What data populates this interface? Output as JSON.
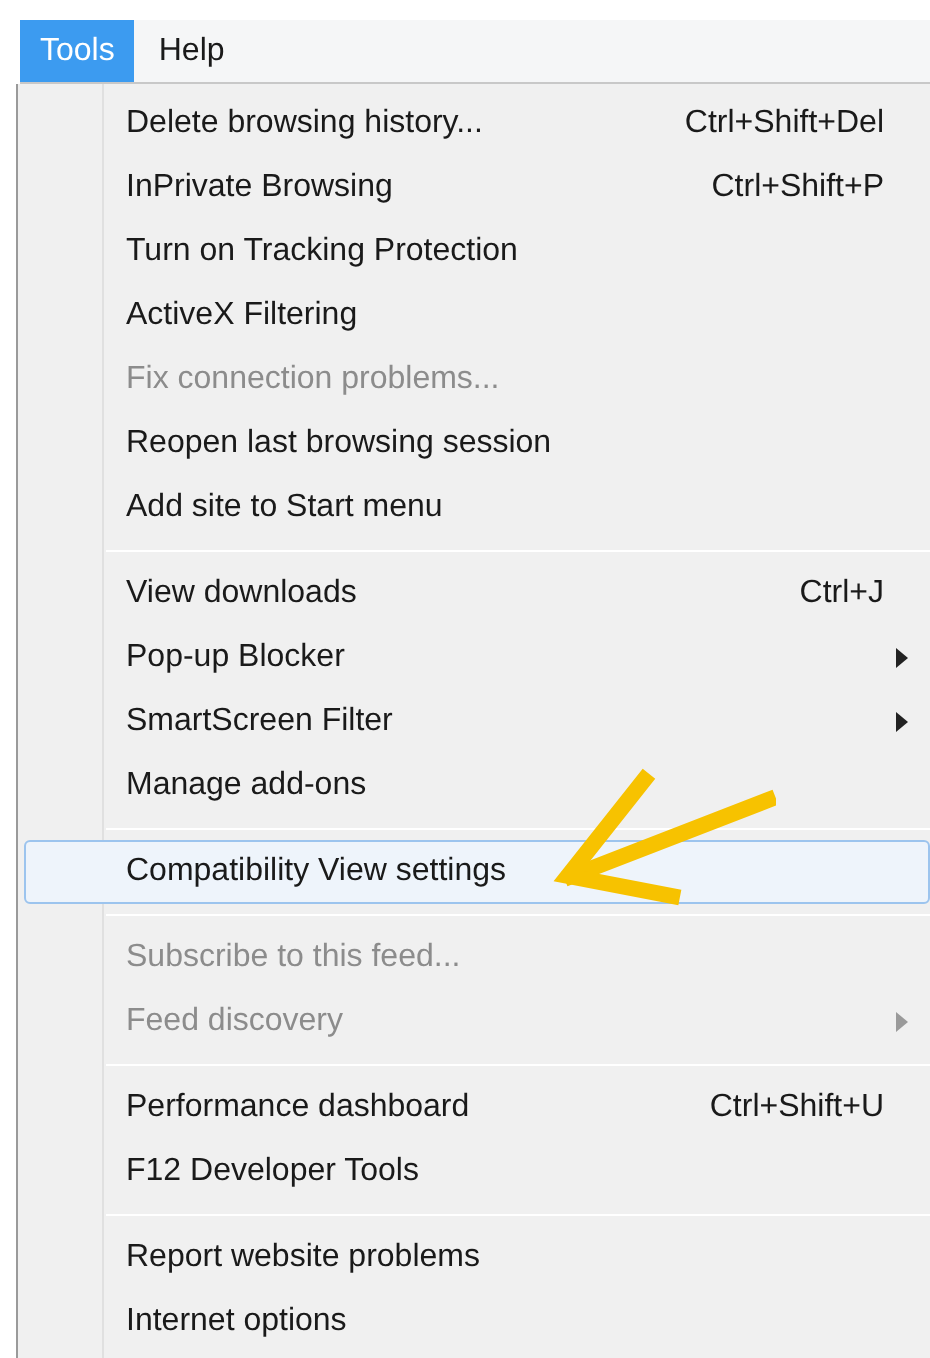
{
  "menubar": [
    {
      "label": "Tools",
      "selected": true
    },
    {
      "label": "Help",
      "selected": false
    }
  ],
  "menu": {
    "groups": [
      {
        "items": [
          {
            "label": "Delete browsing history...",
            "shortcut": "Ctrl+Shift+Del",
            "disabled": false,
            "selected": false,
            "submenu": false
          },
          {
            "label": "InPrivate Browsing",
            "shortcut": "Ctrl+Shift+P",
            "disabled": false,
            "selected": false,
            "submenu": false
          },
          {
            "label": "Turn on Tracking Protection",
            "disabled": false,
            "selected": false,
            "submenu": false
          },
          {
            "label": "ActiveX Filtering",
            "disabled": false,
            "selected": false,
            "submenu": false
          },
          {
            "label": "Fix connection problems...",
            "disabled": true,
            "selected": false,
            "submenu": false
          },
          {
            "label": "Reopen last browsing session",
            "disabled": false,
            "selected": false,
            "submenu": false
          },
          {
            "label": "Add site to Start menu",
            "disabled": false,
            "selected": false,
            "submenu": false
          }
        ]
      },
      {
        "items": [
          {
            "label": "View downloads",
            "shortcut": "Ctrl+J",
            "disabled": false,
            "selected": false,
            "submenu": false
          },
          {
            "label": "Pop-up Blocker",
            "disabled": false,
            "selected": false,
            "submenu": true
          },
          {
            "label": "SmartScreen Filter",
            "disabled": false,
            "selected": false,
            "submenu": true
          },
          {
            "label": "Manage add-ons",
            "disabled": false,
            "selected": false,
            "submenu": false
          }
        ]
      },
      {
        "items": [
          {
            "label": "Compatibility View settings",
            "disabled": false,
            "selected": true,
            "submenu": false
          }
        ]
      },
      {
        "items": [
          {
            "label": "Subscribe to this feed...",
            "disabled": true,
            "selected": false,
            "submenu": false
          },
          {
            "label": "Feed discovery",
            "disabled": true,
            "selected": false,
            "submenu": true
          }
        ]
      },
      {
        "items": [
          {
            "label": "Performance dashboard",
            "shortcut": "Ctrl+Shift+U",
            "disabled": false,
            "selected": false,
            "submenu": false
          },
          {
            "label": "F12 Developer Tools",
            "disabled": false,
            "selected": false,
            "submenu": false
          }
        ]
      },
      {
        "items": [
          {
            "label": "Report website problems",
            "disabled": false,
            "selected": false,
            "submenu": false
          },
          {
            "label": "Internet options",
            "disabled": false,
            "selected": false,
            "submenu": false
          }
        ]
      }
    ]
  }
}
